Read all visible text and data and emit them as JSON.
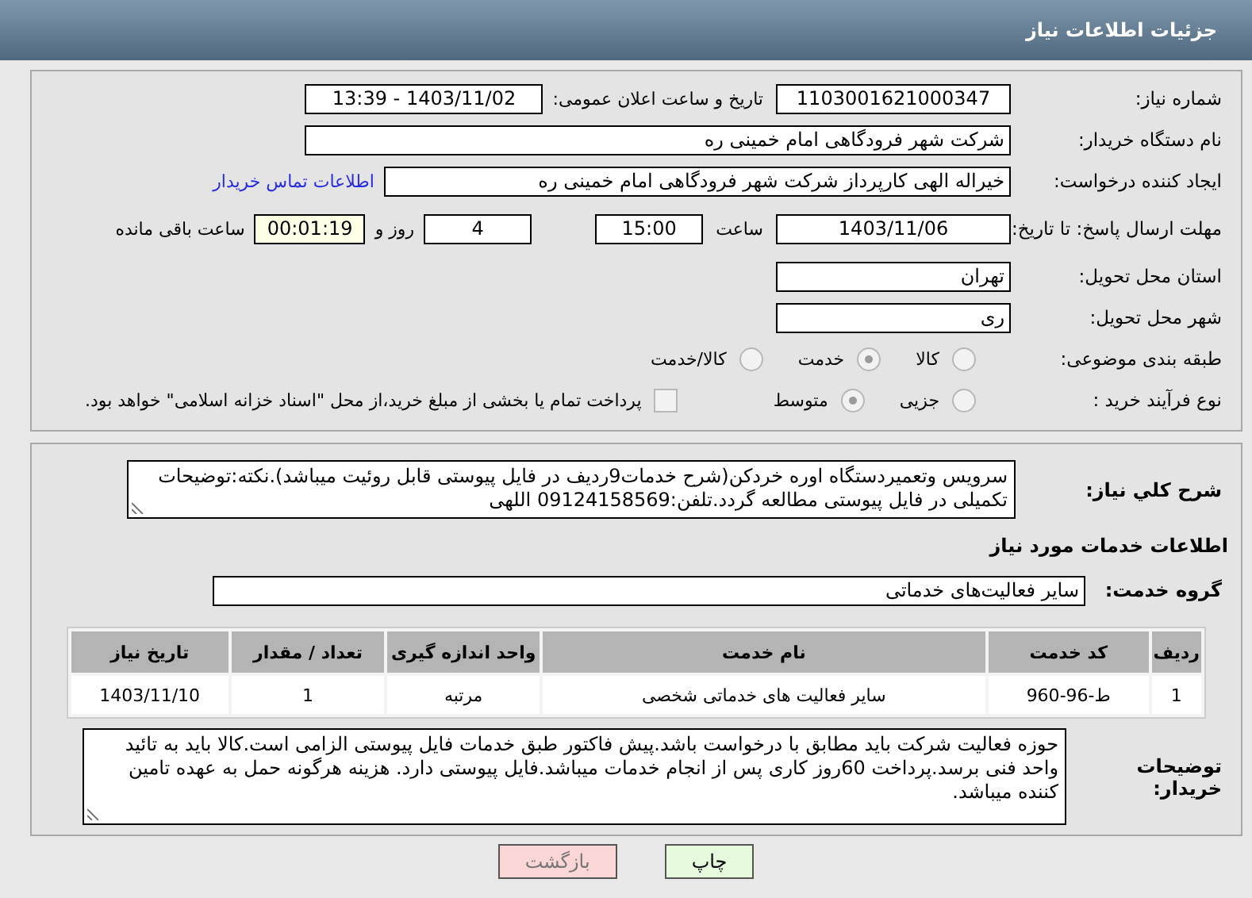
{
  "title": "جزئیات اطلاعات نیاز",
  "need_number": {
    "label": "شماره نیاز:",
    "value": "1103001621000347"
  },
  "announce": {
    "label": "تاریخ و ساعت اعلان عمومی:",
    "value": "1403/11/02 - 13:39"
  },
  "buyer": {
    "label": "نام دستگاه خریدار:",
    "value": "شرکت شهر فرودگاهی امام خمینی  ره"
  },
  "creator": {
    "label": "ایجاد کننده درخواست:",
    "value": "خیراله الهی کارپرداز شرکت شهر فرودگاهی امام خمینی  ره",
    "link": "اطلاعات تماس خریدار"
  },
  "deadline": {
    "label": "مهلت ارسال پاسخ: تا تاریخ:",
    "date": "1403/11/06",
    "time_label": "ساعت",
    "time": "15:00",
    "days": "4",
    "days_label": "روز و",
    "remaining": "00:01:19",
    "remaining_label": "ساعت باقی مانده"
  },
  "province": {
    "label": "استان محل تحویل:",
    "value": "تهران"
  },
  "city": {
    "label": "شهر محل تحویل:",
    "value": "ری"
  },
  "category": {
    "label": "طبقه بندی موضوعی:",
    "options": [
      {
        "label": "کالا",
        "selected": false
      },
      {
        "label": "خدمت",
        "selected": true
      },
      {
        "label": "کالا/خدمت",
        "selected": false
      }
    ]
  },
  "process": {
    "label": "نوع فرآیند خرید :",
    "options": [
      {
        "label": "جزیی",
        "selected": false
      },
      {
        "label": "متوسط",
        "selected": true
      }
    ],
    "payment": {
      "checked": false,
      "text": "پرداخت تمام یا بخشی از مبلغ خرید،از محل \"اسناد خزانه اسلامی\" خواهد بود."
    }
  },
  "summary": {
    "label": "شرح كلي نياز:",
    "value": "سرویس وتعمیردستگاه اوره خردکن(شرح خدمات9ردیف در فایل پیوستی قابل روئیت میباشد).نکته:توضیحات تکمیلی در فایل پیوستی مطالعه گردد.تلفن:09124158569 اللهی"
  },
  "services_heading": "اطلاعات خدمات مورد نیاز",
  "service_group": {
    "label": "گروه خدمت:",
    "value": "سایر فعالیت‌های خدماتی"
  },
  "table": {
    "columns": [
      "ردیف",
      "کد خدمت",
      "نام خدمت",
      "واحد اندازه گیری",
      "تعداد / مقدار",
      "تاریخ نیاز"
    ],
    "rows": [
      [
        "1",
        "ط-96-960",
        "سایر فعالیت های خدماتی شخصی",
        "مرتبه",
        "1",
        "1403/11/10"
      ]
    ]
  },
  "buyer_notes": {
    "label": "توضیحات خریدار:",
    "value": "حوزه فعالیت شرکت باید مطابق با درخواست باشد.پیش فاکتور طبق خدمات فایل پیوستی الزامی است.کالا باید به تائید واحد فنی برسد.پرداخت 60روز کاری پس از انجام خدمات میباشد.فایل پیوستی دارد. هزینه هرگونه حمل به عهده تامین کننده میباشد."
  },
  "buttons": [
    {
      "label": "چاپ",
      "kind": "print"
    },
    {
      "label": "بازگشت",
      "kind": "back"
    }
  ]
}
